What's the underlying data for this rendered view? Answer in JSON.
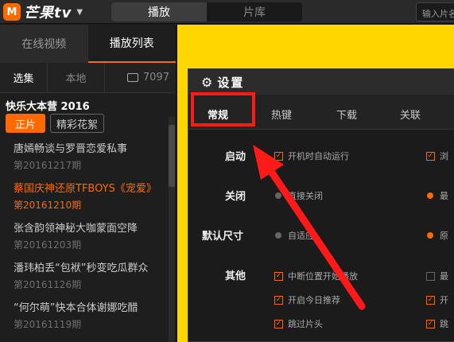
{
  "topbar": {
    "logo_mark": "M",
    "logo_text": "芒果tv",
    "tabs": [
      {
        "label": "播放"
      },
      {
        "label": "片库"
      }
    ],
    "search_placeholder": "输入片名"
  },
  "left": {
    "tabs": [
      {
        "label": "在线视频"
      },
      {
        "label": "播放列表"
      }
    ],
    "subtabs": [
      {
        "label": "选集"
      },
      {
        "label": "本地"
      },
      {
        "label": "7097"
      }
    ],
    "show_title": "快乐大本营 2016",
    "pills": [
      {
        "label": "正片"
      },
      {
        "label": "精彩花絮"
      }
    ],
    "episodes": [
      {
        "title": "唐嫣畅谈与罗晋恋爱私事",
        "date": "第20161217期"
      },
      {
        "title": "蔡国庆神还原TFBOYS《宠爱》",
        "date": "第20161210期"
      },
      {
        "title": "张含韵领神秘大咖蒙面空降",
        "date": "第20161203期"
      },
      {
        "title": "潘玮柏丢“包袱”秒变吃瓜群众",
        "date": "第20161126期"
      },
      {
        "title": "“何尔萌”快本合体谢娜吃醋",
        "date": "第20161119期"
      }
    ]
  },
  "settings": {
    "title": "设置",
    "tabs": [
      {
        "label": "常规"
      },
      {
        "label": "热键"
      },
      {
        "label": "下载"
      },
      {
        "label": "关联"
      }
    ],
    "rows": [
      {
        "label": "启动",
        "left": "开机时自动运行",
        "right": "浏"
      },
      {
        "label": "关闭",
        "left": "直接关闭",
        "right": "最"
      },
      {
        "label": "默认尺寸",
        "left": "自适应",
        "right": "原"
      },
      {
        "label": "其他",
        "options": [
          {
            "left": "中断位置开始播放",
            "right": "最"
          },
          {
            "left": "开启今日推荐",
            "right": "开"
          },
          {
            "left": "跳过片头",
            "right": "跳"
          }
        ]
      }
    ]
  },
  "colors": {
    "accent": "#ff6a00",
    "highlight": "#ff1a1a",
    "stage": "#ffd600"
  }
}
